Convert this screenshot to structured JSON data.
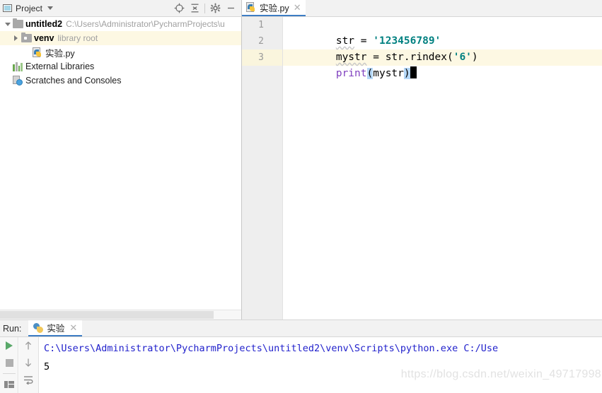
{
  "project_panel": {
    "title": "Project",
    "window_icon": "project-window-icon",
    "dropdown_icon": "chevron-down-icon",
    "toolbar": [
      {
        "name": "locate-target-icon",
        "label": ""
      },
      {
        "name": "collapse-all-icon",
        "label": ""
      },
      {
        "name": "gear-icon",
        "label": ""
      },
      {
        "name": "hide-icon",
        "label": ""
      }
    ],
    "tree": [
      {
        "label": "untitled2",
        "secondary": "C:\\Users\\Administrator\\PycharmProjects\\u",
        "icon": "folder-icon",
        "arrow": "expanded",
        "indent": 4,
        "bold": true,
        "selected": false
      },
      {
        "label": "venv",
        "secondary": "library root",
        "icon": "library-folder-icon",
        "arrow": "collapsed",
        "indent": 16,
        "bold": true,
        "selected": true
      },
      {
        "label": "实验.py",
        "secondary": "",
        "icon": "python-file-icon",
        "arrow": "none",
        "indent": 32,
        "bold": false,
        "selected": false
      },
      {
        "label": "External Libraries",
        "secondary": "",
        "icon": "external-libraries-icon",
        "arrow": "expandable",
        "indent": 4,
        "bold": false,
        "selected": false
      },
      {
        "label": "Scratches and Consoles",
        "secondary": "",
        "icon": "scratches-icon",
        "arrow": "none",
        "indent": 4,
        "bold": false,
        "selected": false
      }
    ]
  },
  "editor": {
    "tab": {
      "label": "实验.py",
      "icon": "python-file-icon",
      "close_icon": "close-icon"
    },
    "line_numbers": [
      "1",
      "2",
      "3"
    ],
    "current_line": 3,
    "lines": [
      {
        "number": "1",
        "tokens": [
          {
            "text": "str",
            "type": "default-squiggle"
          },
          {
            "text": " = ",
            "type": "default"
          },
          {
            "text": "'123456789'",
            "type": "string"
          }
        ]
      },
      {
        "number": "2",
        "tokens": [
          {
            "text": "mystr",
            "type": "default-squiggle"
          },
          {
            "text": " = str.rindex(",
            "type": "default"
          },
          {
            "text": "'6'",
            "type": "string"
          },
          {
            "text": ")",
            "type": "default"
          }
        ]
      },
      {
        "number": "3",
        "tokens": [
          {
            "text": "print",
            "type": "keyword"
          },
          {
            "text": "(",
            "type": "brace-highlight"
          },
          {
            "text": "mystr",
            "type": "default"
          },
          {
            "text": ")",
            "type": "brace-highlight"
          }
        ],
        "caret": true
      }
    ]
  },
  "run_window": {
    "label": "Run:",
    "tab": {
      "label": "实验",
      "icon": "python-logo-icon",
      "close_icon": "close-icon"
    },
    "toolbar_left": [
      {
        "name": "rerun-icon",
        "label": ""
      },
      {
        "name": "stop-icon",
        "label": ""
      },
      {
        "name": "layout-icon",
        "label": ""
      }
    ],
    "toolbar_second": [
      {
        "name": "up-arrow-icon",
        "label": ""
      },
      {
        "name": "down-arrow-icon",
        "label": ""
      },
      {
        "name": "soft-wrap-icon",
        "label": ""
      }
    ],
    "console": [
      {
        "text": "C:\\Users\\Administrator\\PycharmProjects\\untitled2\\venv\\Scripts\\python.exe C:/Use",
        "type": "command"
      },
      {
        "text": "5",
        "type": "result"
      }
    ],
    "watermark": "https://blog.csdn.net/weixin_49717998"
  },
  "colors": {
    "accent": "#3d7dc4",
    "string_token": "#008080",
    "keyword_token": "#7f3fbf",
    "console_text": "#2222cc",
    "selection_highlight": "#fdf8e3",
    "brace_highlight": "#b5d7f7",
    "run_green": "#59a869"
  }
}
